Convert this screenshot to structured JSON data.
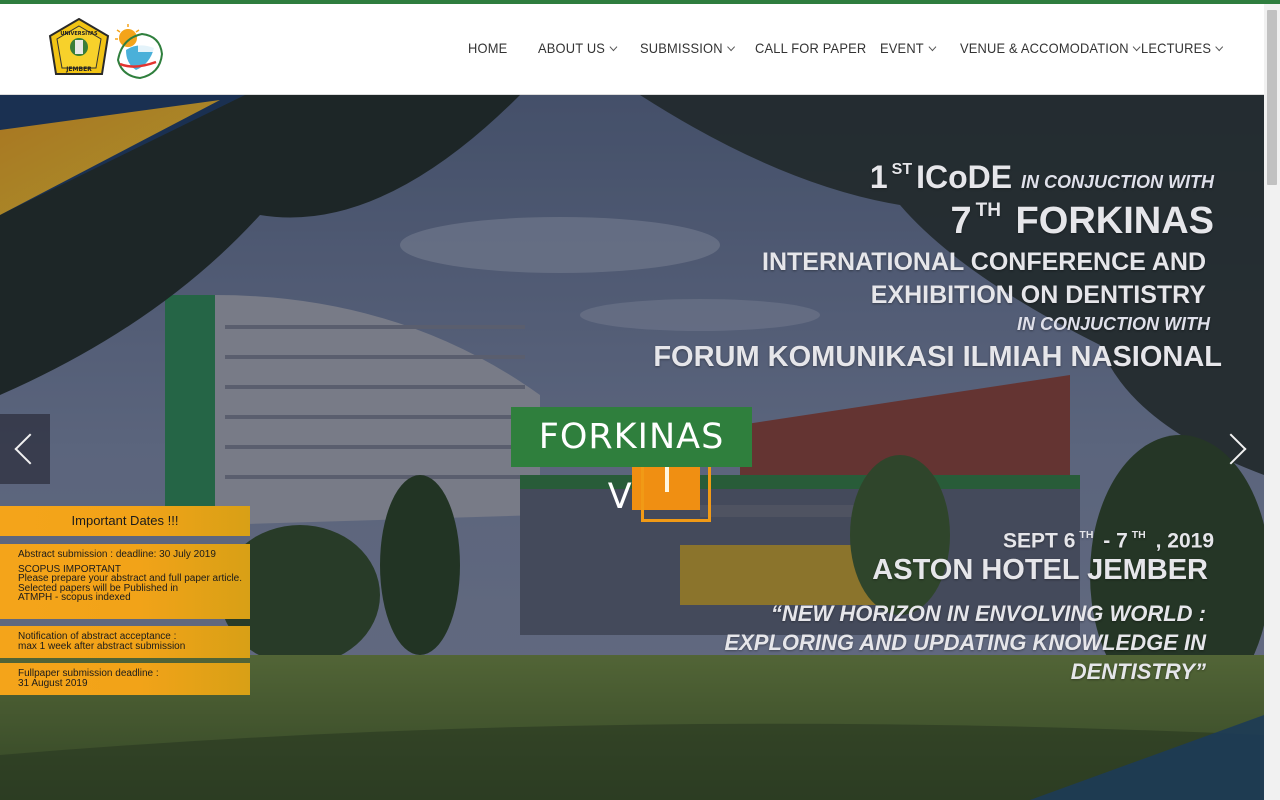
{
  "colors": {
    "accent_green": "#2e7d3e",
    "accent_orange": "#f19a16",
    "nav_text": "#333333"
  },
  "logos": [
    {
      "name": "universitas-jember-logo",
      "text": "UNIVERSITAS JEMBER"
    },
    {
      "name": "conference-logo"
    }
  ],
  "nav": {
    "home": "HOME",
    "about": "ABOUT US",
    "submission": "SUBMISSION",
    "call": "CALL FOR PAPER",
    "event": "EVENT",
    "venue": "VENUE & ACCOMODATION",
    "lectures": "LECTURES"
  },
  "hero": {
    "line1_num": "1",
    "line1_sup": "ST",
    "line1_title": "ICoDE",
    "line1_tail": "IN CONJUCTION WITH",
    "line2_num": "7",
    "line2_sup": "TH",
    "line2_title": "FORKINAS",
    "line3": "INTERNATIONAL CONFERENCE AND",
    "line4": "EXHIBITION ON DENTISTRY",
    "line5": "IN CONJUCTION WITH",
    "line6": "FORUM KOMUNIKASI ILMIAH NASIONAL",
    "badge": "FORKINAS VII",
    "date_a": "SEPT 6",
    "date_a_sup": "TH",
    "date_b": "- 7",
    "date_b_sup": "TH",
    "date_c": ", 2019",
    "venue": "ASTON HOTEL JEMBER",
    "theme1": "“NEW HORIZON IN ENVOLVING WORLD :",
    "theme2": "EXPLORING AND UPDATING KNOWLEDGE IN",
    "theme3": "DENTISTRY”"
  },
  "important_dates": {
    "title": "Important Dates !!!",
    "box1": [
      "Abstract submission : deadline: 30 July 2019",
      "SCOPUS IMPORTANT",
      "Please prepare your abstract and full paper article.",
      "Selected papers will be Published in",
      "ATMPH  -  scopus indexed"
    ],
    "box2": [
      "Notification of abstract acceptance :",
      "max 1 week after abstract submission"
    ],
    "box3": [
      "Fullpaper submission deadline :",
      "31 August 2019"
    ]
  }
}
